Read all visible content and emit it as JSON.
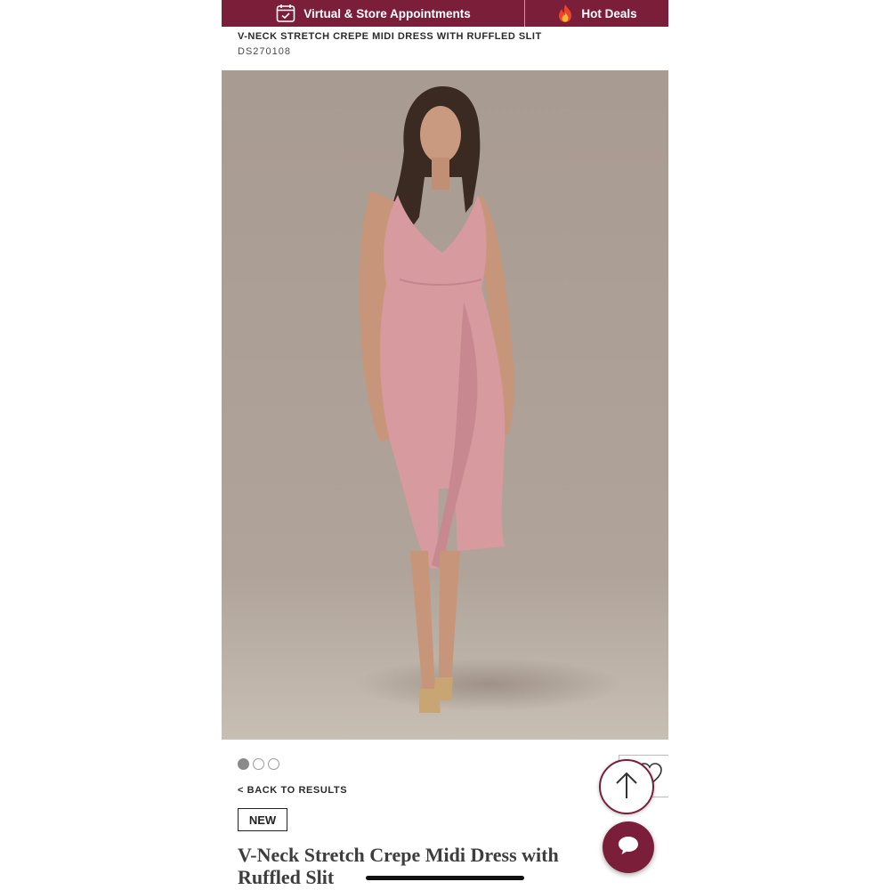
{
  "promo_bar": {
    "appointments_label": "Virtual & Store Appointments",
    "deals_label": "Hot Deals",
    "background": "#7a1e3a"
  },
  "product": {
    "sku_title": "V-NECK STRETCH CREPE MIDI DRESS WITH RUFFLED SLIT",
    "sku_code": "DS270108",
    "image_alt": "Model wearing pink V-neck stretch crepe midi dress with ruffled slit",
    "badge": "NEW",
    "title": "V-Neck Stretch Crepe Midi Dress with Ruffled Slit",
    "dress_color": "#d9969e"
  },
  "carousel": {
    "image_count": 3,
    "active_index": 0
  },
  "navigation": {
    "back_label": "< BACK TO RESULTS"
  },
  "icons": {
    "appointments": "calendar-check-icon",
    "deals": "flame-icon",
    "scroll_top": "arrow-up-icon",
    "wishlist": "heart-icon",
    "chat": "chat-bubble-icon"
  },
  "colors": {
    "brand": "#7a1e3a",
    "image_backdrop": "#aa9d92"
  }
}
